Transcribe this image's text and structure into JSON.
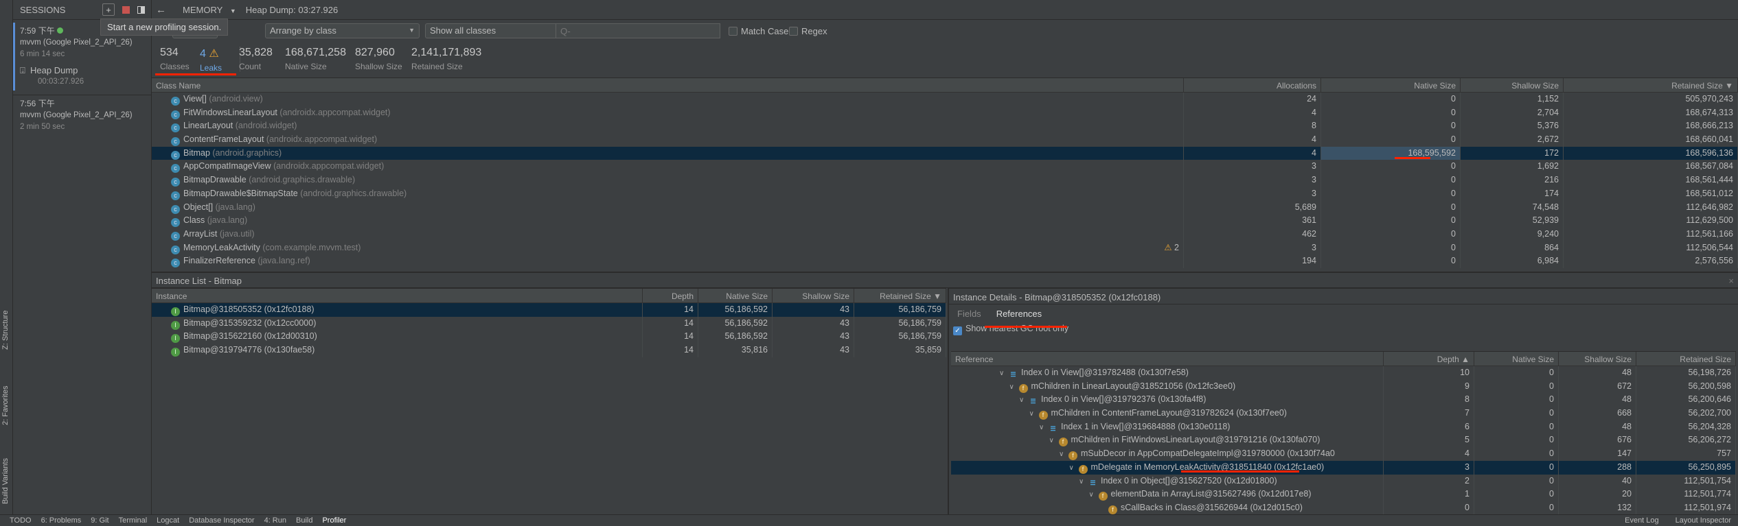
{
  "sessions": {
    "title": "SESSIONS",
    "tooltip": "Start a new profiling session.",
    "items": [
      {
        "time": "7:59 下午",
        "device": "mvvm (Google Pixel_2_API_26)",
        "duration": "6 min 14 sec",
        "live": true,
        "artifact": {
          "label": "Heap Dump",
          "time": "00:03:27.926"
        }
      },
      {
        "time": "7:56 下午",
        "device": "mvvm (Google Pixel_2_API_26)",
        "duration": "2 min 50 sec"
      }
    ]
  },
  "side_tools": [
    "Z: Structure",
    "2: Favorites",
    "Build Variants"
  ],
  "topbar": {
    "profiler": "MEMORY",
    "title": "Heap Dump: 03:27.926"
  },
  "filters": {
    "arrange": "Arrange by class",
    "show": "Show all classes",
    "search_placeholder": "Q-",
    "match_case": "Match Case",
    "regex": "Regex"
  },
  "stats": [
    {
      "value": "534",
      "label": "Classes"
    },
    {
      "value": "4",
      "label": "Leaks"
    },
    {
      "value": "35,828",
      "label": "Count"
    },
    {
      "value": "168,671,258",
      "label": "Native Size"
    },
    {
      "value": "827,960",
      "label": "Shallow Size"
    },
    {
      "value": "2,141,171,893",
      "label": "Retained Size"
    }
  ],
  "class_table": {
    "columns": [
      "Class Name",
      "Allocations",
      "Native Size",
      "Shallow Size",
      "Retained Size ▼"
    ],
    "rows": [
      {
        "name": "View[]",
        "pkg": "(android.view)",
        "alloc": "24",
        "native": "0",
        "shallow": "1,152",
        "retained": "505,970,243"
      },
      {
        "name": "FitWindowsLinearLayout",
        "pkg": "(androidx.appcompat.widget)",
        "alloc": "4",
        "native": "0",
        "shallow": "2,704",
        "retained": "168,674,313"
      },
      {
        "name": "LinearLayout",
        "pkg": "(android.widget)",
        "alloc": "8",
        "native": "0",
        "shallow": "5,376",
        "retained": "168,666,213"
      },
      {
        "name": "ContentFrameLayout",
        "pkg": "(androidx.appcompat.widget)",
        "alloc": "4",
        "native": "0",
        "shallow": "2,672",
        "retained": "168,660,041"
      },
      {
        "name": "Bitmap",
        "pkg": "(android.graphics)",
        "alloc": "4",
        "native": "168,595,592",
        "shallow": "172",
        "retained": "168,596,136",
        "selected": true
      },
      {
        "name": "AppCompatImageView",
        "pkg": "(androidx.appcompat.widget)",
        "alloc": "3",
        "native": "0",
        "shallow": "1,692",
        "retained": "168,567,084"
      },
      {
        "name": "BitmapDrawable",
        "pkg": "(android.graphics.drawable)",
        "alloc": "3",
        "native": "0",
        "shallow": "216",
        "retained": "168,561,444"
      },
      {
        "name": "BitmapDrawable$BitmapState",
        "pkg": "(android.graphics.drawable)",
        "alloc": "3",
        "native": "0",
        "shallow": "174",
        "retained": "168,561,012"
      },
      {
        "name": "Object[]",
        "pkg": "(java.lang)",
        "alloc": "5,689",
        "native": "0",
        "shallow": "74,548",
        "retained": "112,646,982"
      },
      {
        "name": "Class",
        "pkg": "(java.lang)",
        "alloc": "361",
        "native": "0",
        "shallow": "52,939",
        "retained": "112,629,500"
      },
      {
        "name": "ArrayList",
        "pkg": "(java.util)",
        "alloc": "462",
        "native": "0",
        "shallow": "9,240",
        "retained": "112,561,166"
      },
      {
        "name": "MemoryLeakActivity",
        "pkg": "(com.example.mvvm.test)",
        "leaks": "2",
        "alloc": "3",
        "native": "0",
        "shallow": "864",
        "retained": "112,506,544"
      },
      {
        "name": "FinalizerReference",
        "pkg": "(java.lang.ref)",
        "alloc": "194",
        "native": "0",
        "shallow": "6,984",
        "retained": "2,576,556"
      }
    ]
  },
  "instance_list": {
    "title": "Instance List - Bitmap",
    "columns": [
      "Instance",
      "Depth",
      "Native Size",
      "Shallow Size",
      "Retained Size ▼"
    ],
    "rows": [
      {
        "name": "Bitmap@318505352 (0x12fc0188)",
        "depth": "14",
        "native": "56,186,592",
        "shallow": "43",
        "retained": "56,186,759",
        "selected": true
      },
      {
        "name": "Bitmap@315359232 (0x12cc0000)",
        "depth": "14",
        "native": "56,186,592",
        "shallow": "43",
        "retained": "56,186,759"
      },
      {
        "name": "Bitmap@315622160 (0x12d00310)",
        "depth": "14",
        "native": "56,186,592",
        "shallow": "43",
        "retained": "56,186,759"
      },
      {
        "name": "Bitmap@319794776 (0x130fae58)",
        "depth": "14",
        "native": "35,816",
        "shallow": "43",
        "retained": "35,859"
      }
    ]
  },
  "instance_details": {
    "title": "Instance Details - Bitmap@318505352 (0x12fc0188)",
    "tabs": [
      "Fields",
      "References"
    ],
    "active_tab": "References",
    "gc_root_checkbox": "Show nearest GC root only",
    "columns": [
      "Reference",
      "Depth ▲",
      "Native Size",
      "Shallow Size",
      "Retained Size"
    ],
    "rows": [
      {
        "kind": "index",
        "level": 0,
        "text": "Index 0 in View[]@319782488 (0x130f7e58)",
        "depth": "10",
        "native": "0",
        "shallow": "48",
        "retained": "56,198,726"
      },
      {
        "kind": "field",
        "level": 1,
        "text": "mChildren in LinearLayout@318521056 (0x12fc3ee0)",
        "depth": "9",
        "native": "0",
        "shallow": "672",
        "retained": "56,200,598"
      },
      {
        "kind": "index",
        "level": 2,
        "text": "Index 0 in View[]@319792376 (0x130fa4f8)",
        "depth": "8",
        "native": "0",
        "shallow": "48",
        "retained": "56,200,646"
      },
      {
        "kind": "field",
        "level": 3,
        "text": "mChildren in ContentFrameLayout@319782624 (0x130f7ee0)",
        "depth": "7",
        "native": "0",
        "shallow": "668",
        "retained": "56,202,700"
      },
      {
        "kind": "index",
        "level": 4,
        "text": "Index 1 in View[]@319684888 (0x130e0118)",
        "depth": "6",
        "native": "0",
        "shallow": "48",
        "retained": "56,204,328"
      },
      {
        "kind": "field",
        "level": 5,
        "text": "mChildren in FitWindowsLinearLayout@319791216 (0x130fa070)",
        "depth": "5",
        "native": "0",
        "shallow": "676",
        "retained": "56,206,272"
      },
      {
        "kind": "field",
        "level": 6,
        "text": "mSubDecor in AppCompatDelegateImpl@319780000 (0x130f74a0",
        "depth": "4",
        "native": "0",
        "shallow": "147",
        "retained": "757"
      },
      {
        "kind": "field",
        "level": 7,
        "text": "mDelegate in MemoryLeakActivity@318511840 (0x12fc1ae0)",
        "depth": "3",
        "native": "0",
        "shallow": "288",
        "retained": "56,250,895",
        "selected": true
      },
      {
        "kind": "index",
        "level": 8,
        "text": "Index 0 in Object[]@315627520 (0x12d01800)",
        "depth": "2",
        "native": "0",
        "shallow": "40",
        "retained": "112,501,754"
      },
      {
        "kind": "field",
        "level": 9,
        "text": "elementData in ArrayList@315627496 (0x12d017e8)",
        "depth": "1",
        "native": "0",
        "shallow": "20",
        "retained": "112,501,774"
      },
      {
        "kind": "field",
        "level": 10,
        "leaf": true,
        "text": "sCallBacks in Class@315626944 (0x12d015c0)",
        "depth": "0",
        "native": "0",
        "shallow": "132",
        "retained": "112,501,974"
      }
    ]
  },
  "statusbar": {
    "left": [
      "TODO",
      "6: Problems",
      "9: Git",
      "Terminal",
      "Logcat",
      "Database Inspector",
      "4: Run",
      "Build",
      "Profiler"
    ],
    "right": [
      "Event Log",
      "Layout Inspector"
    ]
  },
  "colors": {
    "selection": "#0d293e",
    "accent": "#4a88c7",
    "annotation": "#ff2200",
    "warning": "#f0a732"
  }
}
